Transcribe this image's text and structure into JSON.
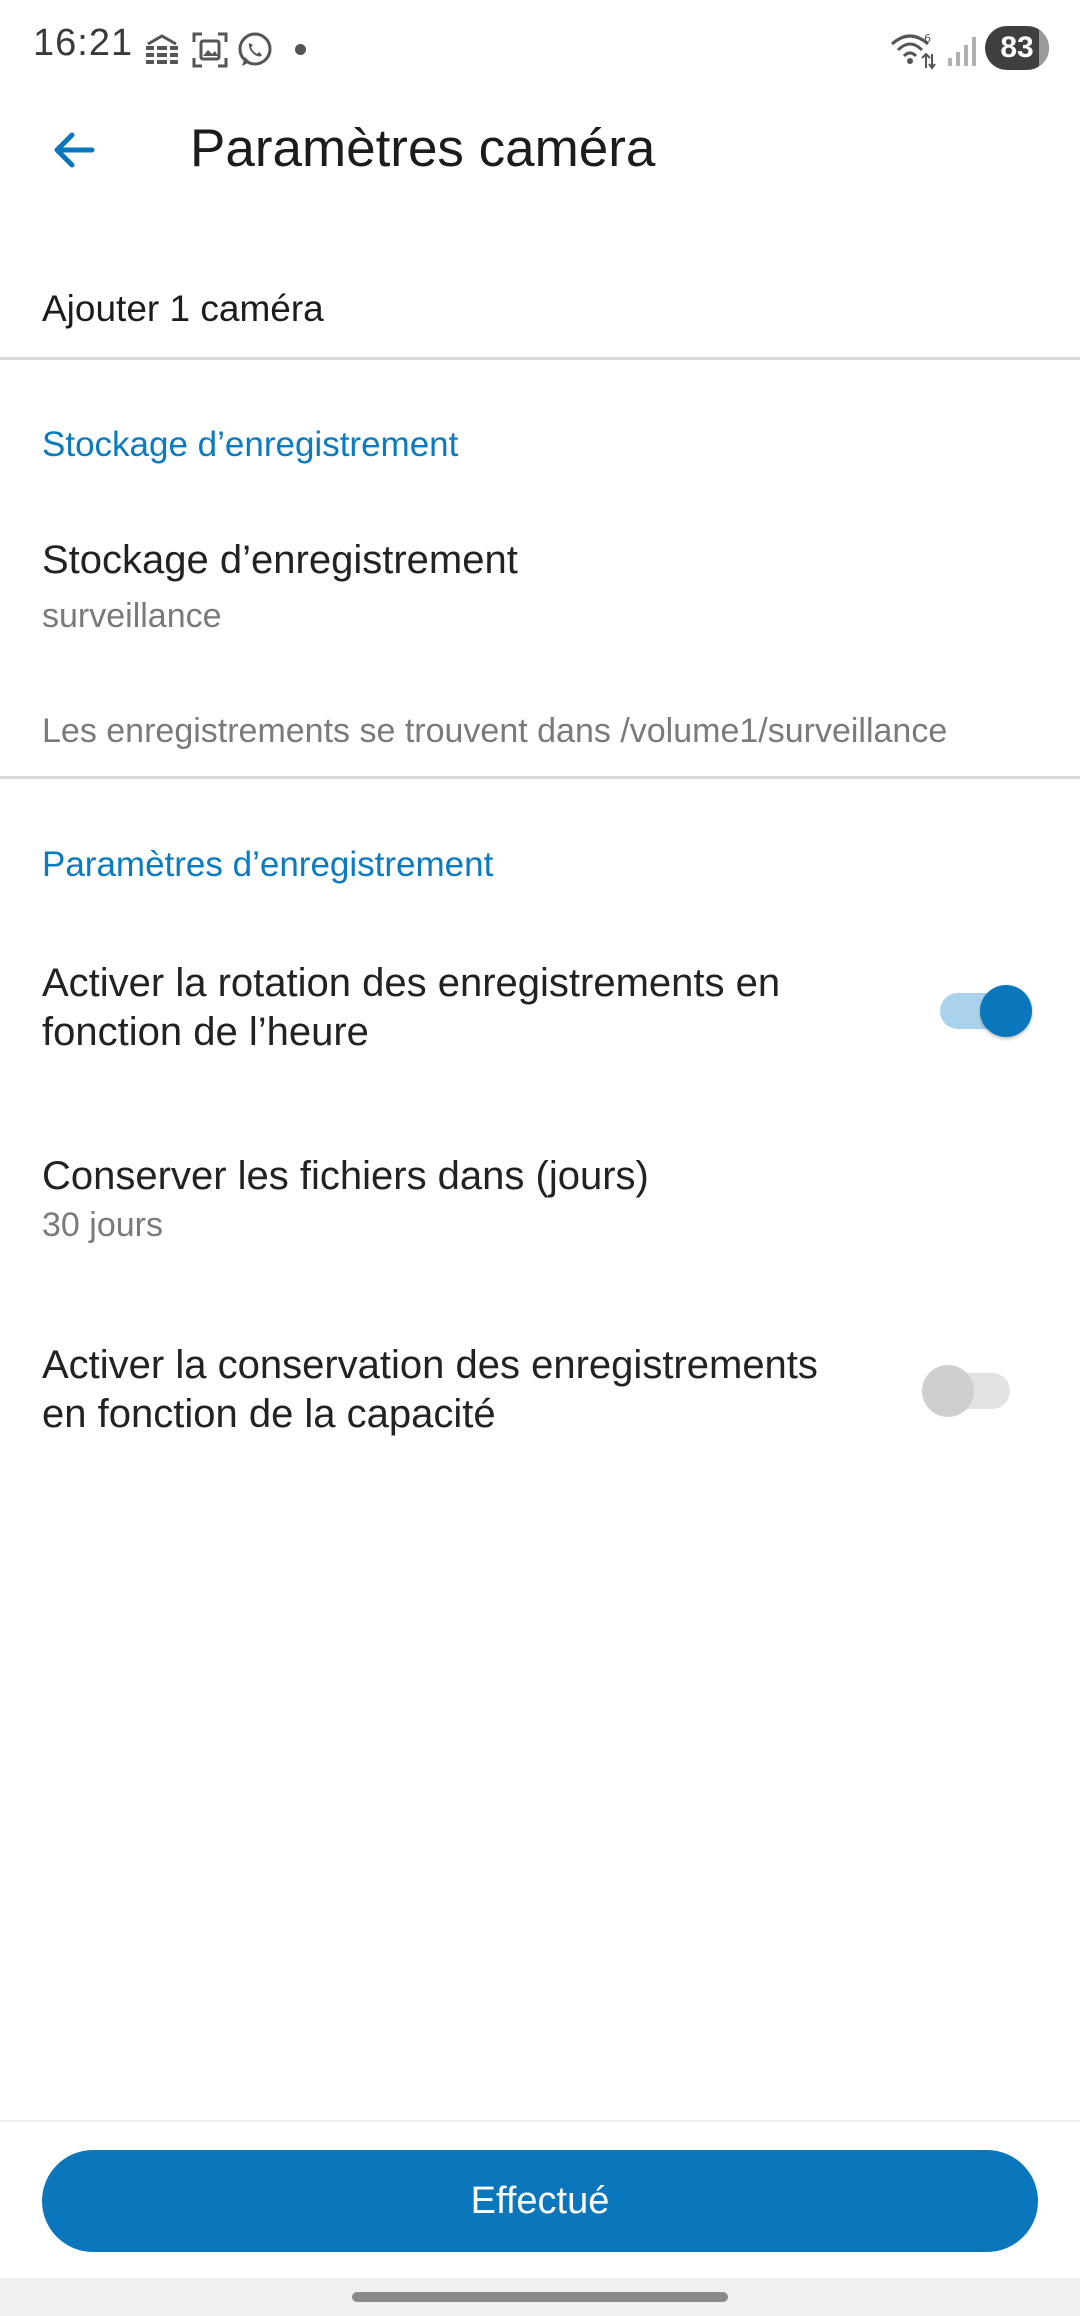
{
  "status_bar": {
    "time": "16:21",
    "icons": [
      "accessibility-icon",
      "screenshot-icon",
      "whatsapp-icon",
      "notification-dot",
      "wifi-icon",
      "signal-icon",
      "battery-icon"
    ],
    "battery_level": "83"
  },
  "app_bar": {
    "title": "Paramètres caméra",
    "back_icon": "back-arrow-icon"
  },
  "content": {
    "add_camera": "Ajouter 1 caméra",
    "storage_section": {
      "header": "Stockage d’enregistrement",
      "item_title": "Stockage d’enregistrement",
      "item_value": "surveillance",
      "info": "Les enregistrements se trouvent dans /volume1/surveillance"
    },
    "recording_section": {
      "header": "Paramètres d’enregistrement",
      "rotation_line1": "Activer la rotation des enregistrements en",
      "rotation_line2": "fonction de l’heure",
      "rotation_enabled": true,
      "keep_title": "Conserver les fichiers dans (jours)",
      "keep_value": "30 jours",
      "capacity_line1": "Activer la conservation des enregistrements",
      "capacity_line2": "en fonction de la capacité",
      "capacity_enabled": false
    }
  },
  "footer": {
    "done_label": "Effectué"
  },
  "colors": {
    "accent": "#0a76bc",
    "section_header": "#0a7bc0",
    "secondary_text": "#7a7a7a"
  }
}
